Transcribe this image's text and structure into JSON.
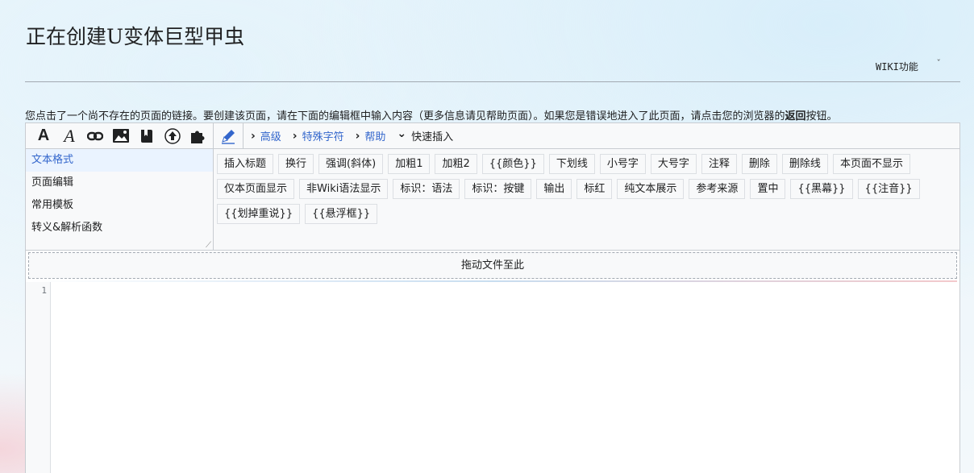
{
  "page": {
    "title": "正在创建U变体巨型甲虫"
  },
  "wiki_tools": {
    "label": "WIKI功能",
    "chevron": "ˇ"
  },
  "notice": {
    "before": "您点击了一个尚不存在的页面的链接。要创建该页面，请在下面的编辑框中输入内容（更多信息请见帮助页面）。如果您是错误地进入了此页面，请点击您的浏览器的",
    "bold": "返回",
    "after": "按钮。"
  },
  "toolbar": {
    "icons": [
      {
        "name": "bold-icon",
        "glyph": "A"
      },
      {
        "name": "italic-icon",
        "glyph": "A"
      },
      {
        "name": "link-icon",
        "glyph": "🔗"
      },
      {
        "name": "image-icon",
        "glyph": "🖼"
      },
      {
        "name": "reference-icon",
        "glyph": "🔖"
      },
      {
        "name": "upload-icon",
        "glyph": "⬆"
      },
      {
        "name": "puzzle-icon",
        "glyph": "🧩"
      },
      {
        "name": "pencil-icon",
        "glyph": "✎"
      }
    ],
    "links": {
      "advanced": "高级",
      "special_chars": "特殊字符",
      "help": "帮助",
      "quick_insert": "快速插入"
    },
    "caret_right": "›",
    "caret_down": "⌄"
  },
  "sections": [
    "文本格式",
    "页面编辑",
    "常用模板",
    "转义&解析函数"
  ],
  "buttons": [
    "插入标题",
    "换行",
    "强调(斜体)",
    "加粗1",
    "加粗2",
    "{{颜色}}",
    "下划线",
    "小号字",
    "大号字",
    "注释",
    "删除",
    "删除线",
    "本页面不显示",
    "仅本页面显示",
    "非Wiki语法显示",
    "标识：语法",
    "标识：按键",
    "输出",
    "标红",
    "纯文本展示",
    "参考来源",
    "置中",
    "{{黑幕}}",
    "{{注音}}",
    "{{划掉重说}}",
    "{{悬浮框}}"
  ],
  "dropzone": {
    "label": "拖动文件至此"
  },
  "editor": {
    "line_number": "1"
  }
}
